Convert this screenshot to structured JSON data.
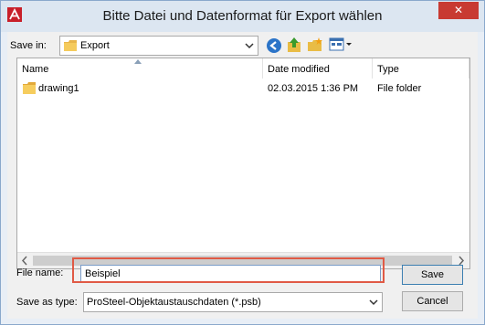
{
  "window": {
    "title": "Bitte Datei und Datenformat für Export wählen",
    "close_symbol": "✕"
  },
  "save_in": {
    "label": "Save in:",
    "value": "Export"
  },
  "list": {
    "columns": [
      "Name",
      "Date modified",
      "Type"
    ],
    "rows": [
      {
        "name": "drawing1",
        "date": "02.03.2015 1:36 PM",
        "type": "File folder"
      }
    ]
  },
  "filename": {
    "label": "File name:",
    "value": "Beispiel"
  },
  "savetype": {
    "label": "Save as type:",
    "value": "ProSteel-Objektaustauschdaten (*.psb)"
  },
  "buttons": {
    "save": "Save",
    "cancel": "Cancel"
  },
  "colors": {
    "highlight": "#e05a45",
    "close": "#c83a32",
    "titlebar": "#dce6f1"
  }
}
